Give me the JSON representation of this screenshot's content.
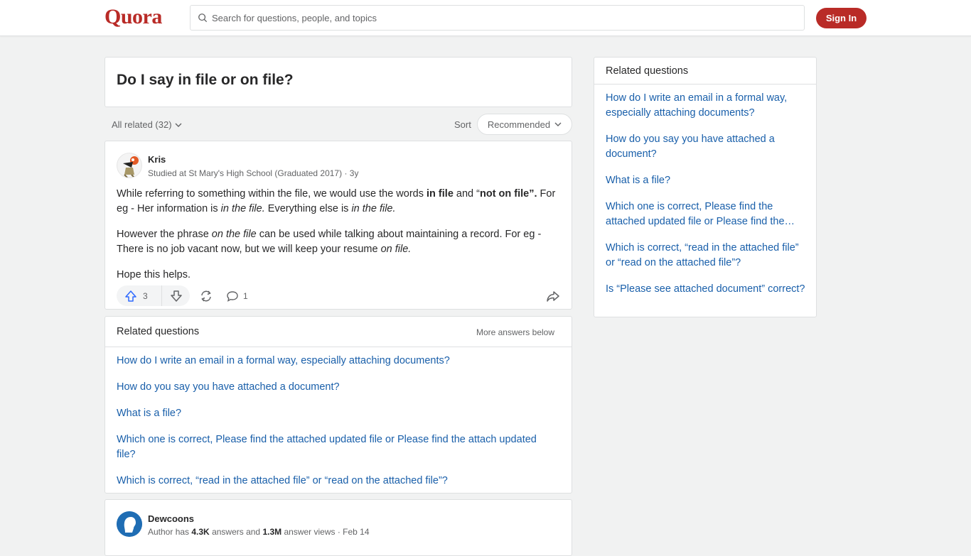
{
  "header": {
    "logo": "Quora",
    "search_placeholder": "Search for questions, people, and topics",
    "signin_label": "Sign In",
    "brand_color": "#b92b27"
  },
  "question": {
    "title": "Do I say in file or on file?"
  },
  "filter": {
    "all_related": "All related (32)",
    "sort_label": "Sort",
    "sort_value": "Recommended"
  },
  "answer": {
    "author": "Kris",
    "credential": "Studied at St Mary's High School (Graduated 2017) · 3y",
    "p1_a": "While referring to something within the file, we would use the words ",
    "p1_b": "in file",
    "p1_c": " and “",
    "p1_d": "not on file”.",
    "p1_e": " For eg - Her information is ",
    "p1_f": "in the file.",
    "p1_g": " Everything else is ",
    "p1_h": "in the file.",
    "p2_a": "However the phrase ",
    "p2_b": "on the file",
    "p2_c": " can be used while talking about maintaining a record. For eg - There is no job vacant now, but we will keep your resume ",
    "p2_d": "on file.",
    "p3": "Hope this helps.",
    "upvotes": "3",
    "comments": "1"
  },
  "related_inline": {
    "title": "Related questions",
    "more": "More answers below",
    "items": [
      "How do I write an email in a formal way, especially attaching documents?",
      "How do you say you have attached a document?",
      "What is a file?",
      "Which one is correct, Please find the attached updated file or Please find the attach updated file?",
      "Which is correct, “read in the attached file” or “read on the attached file”?"
    ]
  },
  "answer2": {
    "author": "Dewcoons",
    "cred_a": "Author has ",
    "cred_b": "4.3K",
    "cred_c": " answers and ",
    "cred_d": "1.3M",
    "cred_e": " answer views · Feb 14"
  },
  "sidebar": {
    "title": "Related questions",
    "items": [
      "How do I write an email in a formal way, especially attaching documents?",
      "How do you say you have attached a document?",
      "What is a file?",
      "Which one is correct, Please find the attached updated file or Please find the attach updated file?",
      "Which is correct, “read in the attached file” or “read on the attached file”?",
      "Is “Please see attached document” correct?"
    ]
  }
}
